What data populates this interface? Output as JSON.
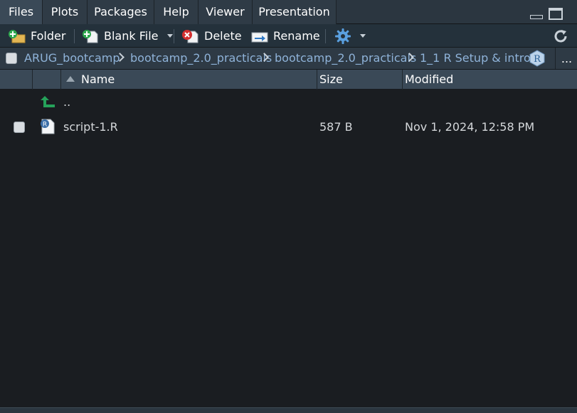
{
  "tabs": [
    {
      "label": "Files",
      "active": true
    },
    {
      "label": "Plots"
    },
    {
      "label": "Packages"
    },
    {
      "label": "Help"
    },
    {
      "label": "Viewer"
    },
    {
      "label": "Presentation"
    }
  ],
  "toolbar": {
    "folder_label": "Folder",
    "blank_file_label": "Blank File",
    "delete_label": "Delete",
    "rename_label": "Rename"
  },
  "path": {
    "crumbs": [
      "ARUG_bootcamp",
      "bootcamp_2.0_practicals",
      "bootcamp_2.0_practicals",
      "1_1 R Setup & intro"
    ],
    "r_badge": "R",
    "more": "..."
  },
  "columns": {
    "name": "Name",
    "size": "Size",
    "modified": "Modified"
  },
  "files": [
    {
      "name": "..",
      "type": "parent"
    },
    {
      "name": "script-1.R",
      "size": "587 B",
      "modified": "Nov 1, 2024, 12:58 PM",
      "icon": "r-script-icon",
      "checked": false
    }
  ],
  "colors": {
    "accent_link": "#8fb3d9",
    "up_arrow": "#25a25a",
    "delete_red": "#d32f2f",
    "gear_blue": "#5aa0e0"
  }
}
